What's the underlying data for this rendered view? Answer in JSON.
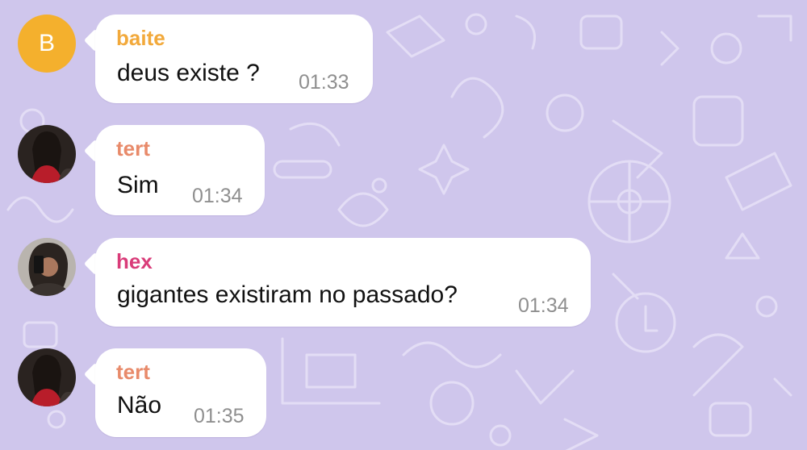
{
  "chat": {
    "messages": [
      {
        "sender": "baite",
        "text": "deus existe ?",
        "time": "01:33",
        "avatar_letter": "B",
        "sender_color": "#f2a93b"
      },
      {
        "sender": "tert",
        "text": "Sim",
        "time": "01:34",
        "sender_color": "#e88a6a"
      },
      {
        "sender": "hex",
        "text": "gigantes existiram no passado?",
        "time": "01:34",
        "sender_color": "#d93c79"
      },
      {
        "sender": "tert",
        "text": "Não",
        "time": "01:35",
        "sender_color": "#e88a6a"
      }
    ]
  }
}
